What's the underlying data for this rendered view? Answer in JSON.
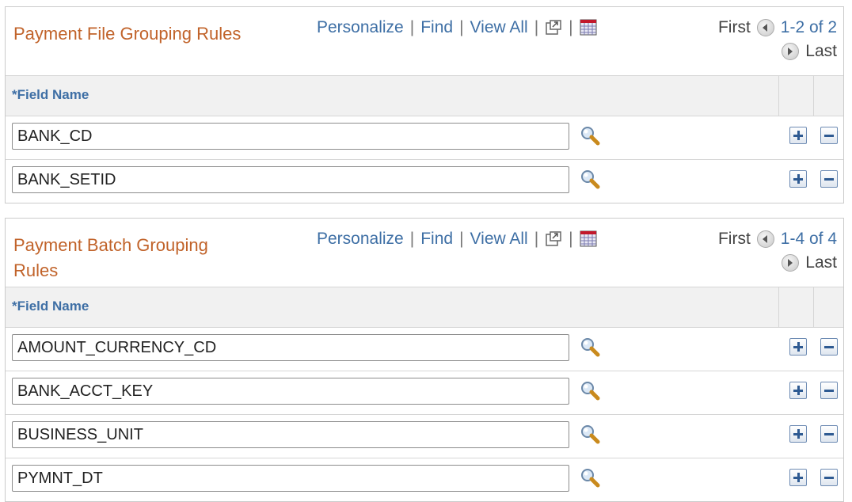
{
  "grids": [
    {
      "title": "Payment File Grouping Rules",
      "nav": {
        "personalize": "Personalize",
        "find": "Find",
        "view_all": "View All",
        "separator": "|"
      },
      "pager": {
        "first": "First",
        "range": "1-2 of 2",
        "last": "Last"
      },
      "column_header": "*Field Name",
      "rows": [
        "BANK_CD",
        "BANK_SETID"
      ]
    },
    {
      "title": "Payment Batch Grouping Rules",
      "nav": {
        "personalize": "Personalize",
        "find": "Find",
        "view_all": "View All",
        "separator": "|"
      },
      "pager": {
        "first": "First",
        "range": "1-4 of 4",
        "last": "Last"
      },
      "column_header": "*Field Name",
      "rows": [
        "AMOUNT_CURRENCY_CD",
        "BANK_ACCT_KEY",
        "BUSINESS_UNIT",
        "PYMNT_DT"
      ]
    }
  ],
  "icons": {
    "zoom": "new-window-icon",
    "download": "spreadsheet-icon",
    "lookup": "magnifier-icon",
    "add": "add-row-icon",
    "delete": "delete-row-icon",
    "prev": "previous-icon",
    "next": "next-icon"
  },
  "colors": {
    "title": "#c1632a",
    "link": "#3e6fa5",
    "header_bg": "#f1f1f1"
  }
}
